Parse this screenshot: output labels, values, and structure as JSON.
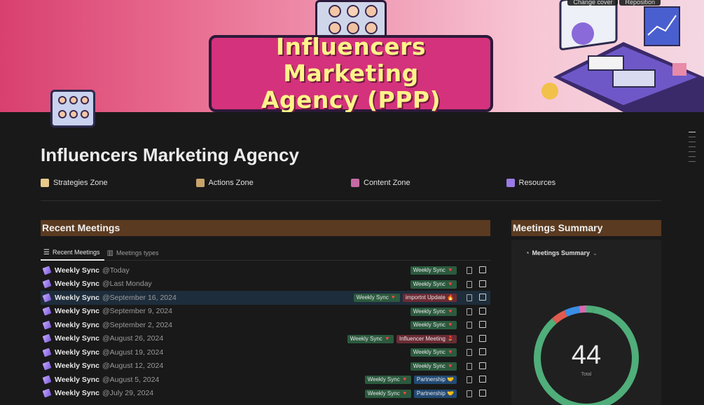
{
  "cover": {
    "banner_line1": "Influencers Marketing",
    "banner_line2": "Agency (PPP)",
    "change_cover": "Change cover",
    "reposition": "Reposition"
  },
  "page": {
    "title": "Influencers Marketing Agency"
  },
  "links": [
    {
      "label": "Strategies Zone",
      "icon": "notepad-icon",
      "color": "#e8c98a"
    },
    {
      "label": "Actions Zone",
      "icon": "clapper-icon",
      "color": "#c9a46a"
    },
    {
      "label": "Content Zone",
      "icon": "book-icon",
      "color": "#c46aa4"
    },
    {
      "label": "Resources",
      "icon": "books-icon",
      "color": "#9a7ae6"
    }
  ],
  "recent": {
    "heading": "Recent Meetings",
    "tabs": [
      {
        "label": "Recent Meetings",
        "icon": "list-icon"
      },
      {
        "label": "Meetings types",
        "icon": "table-icon"
      }
    ],
    "rows": [
      {
        "name": "Weekly Sync",
        "date": "@Today",
        "tags": [
          {
            "label": "Weekly Sync 🔻",
            "color": "green"
          }
        ]
      },
      {
        "name": "Weekly Sync",
        "date": "@Last Monday",
        "tags": [
          {
            "label": "Weekly Sync 🔻",
            "color": "green"
          }
        ]
      },
      {
        "name": "Weekly Sync",
        "date": "@September 16, 2024",
        "tags": [
          {
            "label": "Weekly Sync 🔻",
            "color": "green"
          },
          {
            "label": "importnt Update 🔥",
            "color": "red"
          }
        ]
      },
      {
        "name": "Weekly Sync",
        "date": "@September 9, 2024",
        "tags": [
          {
            "label": "Weekly Sync 🔻",
            "color": "green"
          }
        ]
      },
      {
        "name": "Weekly Sync",
        "date": "@September 2, 2024",
        "tags": [
          {
            "label": "Weekly Sync 🔻",
            "color": "green"
          }
        ]
      },
      {
        "name": "Weekly Sync",
        "date": "@August 26, 2024",
        "tags": [
          {
            "label": "Weekly Sync 🔻",
            "color": "green"
          },
          {
            "label": "Influencer Meeting 💄",
            "color": "red"
          }
        ]
      },
      {
        "name": "Weekly Sync",
        "date": "@August 19, 2024",
        "tags": [
          {
            "label": "Weekly Sync 🔻",
            "color": "green"
          }
        ]
      },
      {
        "name": "Weekly Sync",
        "date": "@August 12, 2024",
        "tags": [
          {
            "label": "Weekly Sync 🔻",
            "color": "green"
          }
        ]
      },
      {
        "name": "Weekly Sync",
        "date": "@August 5, 2024",
        "tags": [
          {
            "label": "Weekly Sync 🔻",
            "color": "green"
          },
          {
            "label": "Partnership 🤝",
            "color": "blue"
          }
        ]
      },
      {
        "name": "Weekly Sync",
        "date": "@July 29, 2024",
        "tags": [
          {
            "label": "Weekly Sync 🔻",
            "color": "green"
          },
          {
            "label": "Partnership 🤝",
            "color": "blue"
          }
        ]
      }
    ]
  },
  "summary": {
    "heading": "Meetings Summary",
    "view_label": "Meetings Summary",
    "total": "44",
    "total_label": "Total",
    "chart_data": {
      "type": "pie",
      "style": "donut",
      "total": 44,
      "slices": [
        {
          "value": 38,
          "color": "#4fae7a"
        },
        {
          "value": 2,
          "color": "#e05a4f"
        },
        {
          "value": 2,
          "color": "#3a8ee6"
        },
        {
          "value": 1,
          "color": "#d46ab1"
        },
        {
          "value": 1,
          "color": "#4fae7a"
        }
      ]
    }
  }
}
